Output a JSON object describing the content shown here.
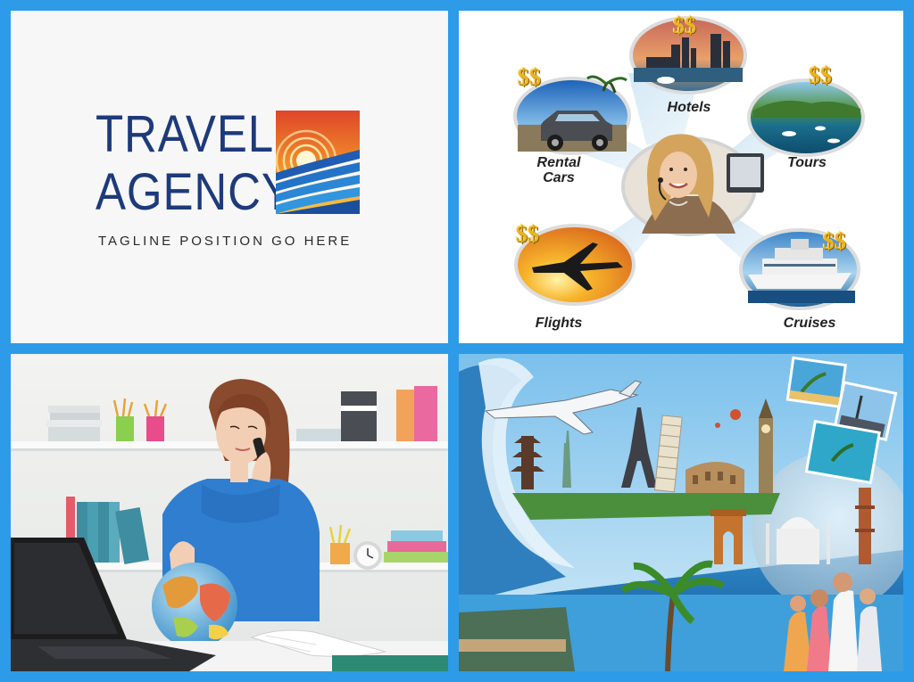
{
  "logo": {
    "line1": "TRAVEL",
    "line2": "AGENCY",
    "tagline": "TAGLINE POSITION GO HERE"
  },
  "services": {
    "hotels": "Hotels",
    "rental_cars": "Rental\nCars",
    "tours": "Tours",
    "flights": "Flights",
    "cruises": "Cruises",
    "price_symbol": "$$"
  },
  "colors": {
    "frame": "#2d9be8",
    "logo_text": "#1d3a7a",
    "dollar": "#e9b323"
  }
}
